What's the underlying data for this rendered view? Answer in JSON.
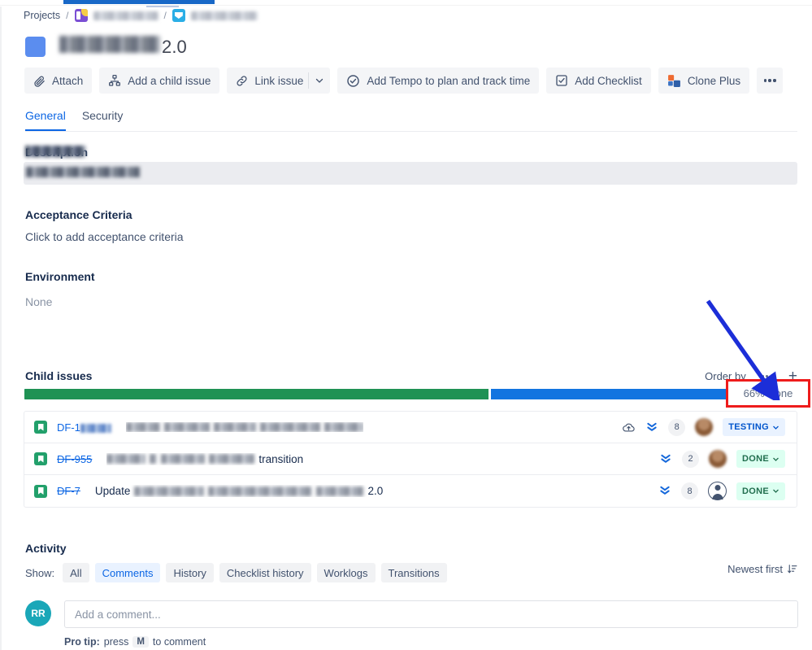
{
  "breadcrumb": {
    "root": "Projects",
    "separator": "/",
    "project_redacted": true,
    "epic_redacted": true
  },
  "header": {
    "title_redacted_prefix": "Tracking",
    "title_visible_tail": "2.0",
    "type_swatch_color": "#5b8def"
  },
  "toolbar": {
    "attach": "Attach",
    "add_child_issue": "Add a child issue",
    "link_issue": "Link issue",
    "add_tempo": "Add Tempo to plan and track time",
    "add_checklist": "Add Checklist",
    "clone_plus": "Clone Plus",
    "more": "..."
  },
  "tabs": [
    {
      "label": "General",
      "active": true
    },
    {
      "label": "Security",
      "active": false
    }
  ],
  "sections": {
    "description": {
      "label": "Description",
      "value_redacted": true
    },
    "acceptance_criteria": {
      "label": "Acceptance Criteria",
      "placeholder": "Click to add acceptance criteria"
    },
    "environment": {
      "label": "Environment",
      "value": "None"
    }
  },
  "child_issues": {
    "label": "Child issues",
    "order_by": "Order by",
    "more_label": "...",
    "add_label": "+",
    "progress": {
      "done_label": "66% Done",
      "done_percent": 66,
      "green_percent": 60,
      "green_color": "#1f9254",
      "blue_color": "#1274e0"
    },
    "rows": [
      {
        "type_icon": "story-icon",
        "key_prefix": "DF-1",
        "key_redacted": true,
        "key_struck": false,
        "summary_redacted": true,
        "summary_visible": "",
        "has_cloud_icon": true,
        "priority_icon": "low-priority-icon",
        "points": "8",
        "avatar": "redacted-photo",
        "status": "TESTING",
        "status_style": "testing"
      },
      {
        "type_icon": "story-icon",
        "key_prefix": "DF-955",
        "key_redacted": true,
        "key_struck": true,
        "summary_redacted": true,
        "summary_visible": "transition",
        "has_cloud_icon": false,
        "priority_icon": "low-priority-icon",
        "points": "2",
        "avatar": "redacted-photo",
        "status": "DONE",
        "status_style": "done"
      },
      {
        "type_icon": "story-icon",
        "key_prefix": "DF-7",
        "key_redacted": true,
        "key_struck": true,
        "summary_redacted": true,
        "summary_prefix": "Update",
        "summary_visible": "2.0",
        "has_cloud_icon": false,
        "priority_icon": "low-priority-icon",
        "points": "8",
        "avatar": "anonymous-icon",
        "status": "DONE",
        "status_style": "done"
      }
    ]
  },
  "activity": {
    "label": "Activity",
    "show_label": "Show:",
    "filters": [
      {
        "label": "All",
        "active": false
      },
      {
        "label": "Comments",
        "active": true
      },
      {
        "label": "History",
        "active": false
      },
      {
        "label": "Checklist history",
        "active": false
      },
      {
        "label": "Worklogs",
        "active": false
      },
      {
        "label": "Transitions",
        "active": false
      }
    ],
    "sort_label": "Newest first"
  },
  "comment": {
    "avatar_initials": "RR",
    "placeholder": "Add a comment...",
    "protip_prefix": "Pro tip:",
    "protip_press": "press",
    "protip_key": "M",
    "protip_suffix": "to comment"
  },
  "annotations": {
    "highlight_color": "#ee1c1c",
    "arrow_color": "#1c2ed8",
    "highlight_target": "66% Done"
  }
}
